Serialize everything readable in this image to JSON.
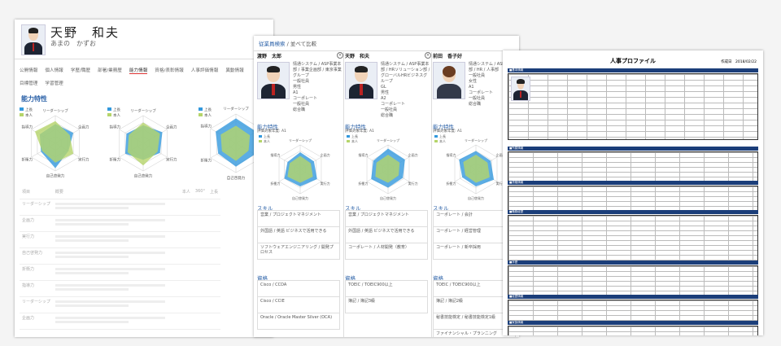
{
  "left": {
    "name": "天野　和夫",
    "kana": "あまの　かずお",
    "tabs": [
      "公開情報",
      "個人情報",
      "学歴/職歴",
      "部署/業務歴",
      "能力情報",
      "資格/表彰情報",
      "人事評価情報",
      "異動情報",
      "目標管理",
      "学習管理"
    ],
    "active_tab": 4,
    "section_title": "能力特性",
    "legend": [
      "上長",
      "本人"
    ],
    "radar_labels": [
      "リーダーシップ",
      "企画力",
      "実行力",
      "自己啓発力",
      "折衝力",
      "指導力"
    ],
    "table_header": [
      "項目",
      "概要",
      "本人",
      "360°",
      "上長"
    ],
    "table_rows": [
      "リーダーシップ",
      "企画力",
      "実行力",
      "自己啓発力",
      "折衝力",
      "指導力",
      "リーダーシップ",
      "企画力"
    ]
  },
  "mid": {
    "breadcrumb": "従業員検索",
    "title": "並べて比較",
    "people": [
      {
        "name": "渡野　太郎",
        "org": "情通システム / ASP事業本部 / 事業企画部 / 東京事業グループ",
        "grade": "一般社員",
        "gender": "男性",
        "level": "A1",
        "biz": "コーポレート",
        "pos": "一般社員",
        "dept": "総合職",
        "skills": [
          "営業 / プロジェクトマネジメント",
          "外国語 / 英語 ビジネスで活用できる",
          "ソフトウェアエンジニアリング / 開発プロセス"
        ],
        "certs": [
          "Cisco / CCDA",
          "Cisco / CCIE",
          "Oracle / Oracle Master Silver (OCA)"
        ]
      },
      {
        "name": "天野　和夫",
        "org": "情通システム / ASP事業本部 / HRソリューション部 / グローバルHRビジネスグループ",
        "grade": "GL",
        "gender": "男性",
        "level": "A2",
        "biz": "コーポレート",
        "pos": "一般社員",
        "dept": "総合職",
        "skills": [
          "営業 / プロジェクトマネジメント",
          "外国語 / 英語 ビジネスで活用できる",
          "コーポレート / 人材開発（教育）"
        ],
        "certs": [
          "TOEIC / TOEIC900以上",
          "簿記 / 簿記3級"
        ]
      },
      {
        "name": "前田　香子好",
        "org": "情通システム / ASP事業本部 / HR / 人事部",
        "grade": "一般社員",
        "gender": "女性",
        "level": "A1",
        "biz": "コーポレート",
        "pos": "一般社員",
        "dept": "総合職",
        "skills": [
          "コーポレート / 会計",
          "コーポレート / 経営管理",
          "コーポレート / 新卒採用"
        ],
        "certs": [
          "TOEIC / TOEIC900以上",
          "簿記 / 簿記2級",
          "秘書技能検定 / 秘書技能検定1級",
          "ファイナンシャル・プランニング"
        ]
      }
    ],
    "section_ability": "能力特性",
    "eval_label": "評価対象年度: A1",
    "legend": [
      "上長",
      "本人"
    ],
    "section_skill": "スキル",
    "section_cert": "資格"
  },
  "right": {
    "title": "人事プロファイル",
    "date": "作成日　2018/02/22",
    "sections": [
      "基本情報",
      "所属情報",
      "資格情報",
      "職務経歴",
      "学歴",
      "経歴情報",
      "家族情報"
    ]
  },
  "colors": {
    "blue": "#3399dd",
    "green": "#b5d56a",
    "accent": "#2c62a8",
    "navy": "#1b3e7a"
  }
}
